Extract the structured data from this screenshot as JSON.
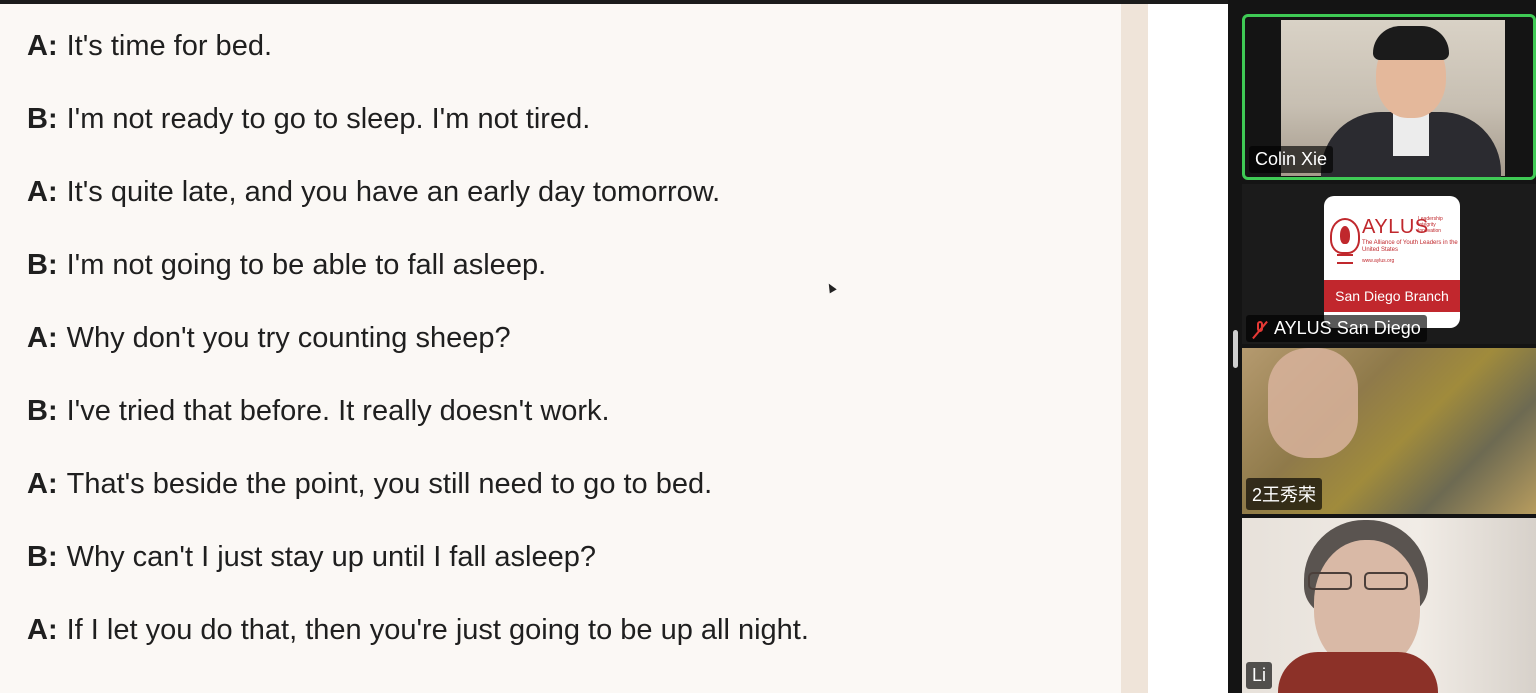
{
  "document": {
    "lines": [
      {
        "speaker": "A:",
        "text": "It's time for bed."
      },
      {
        "speaker": "B:",
        "text": "I'm not ready to go to sleep. I'm not tired."
      },
      {
        "speaker": "A:",
        "text": "It's quite late, and you have an early day tomorrow."
      },
      {
        "speaker": "B:",
        "text": "I'm not going to be able to fall asleep."
      },
      {
        "speaker": "A:",
        "text": "Why don't you try counting sheep?"
      },
      {
        "speaker": "B:",
        "text": "I've tried that before. It really doesn't work."
      },
      {
        "speaker": "A:",
        "text": "That's beside the point, you still need to go to bed."
      },
      {
        "speaker": "B:",
        "text": "Why can't I just stay up until I fall asleep?"
      },
      {
        "speaker": "A:",
        "text": "If I let you do that, then you're just going to be up all night."
      }
    ]
  },
  "participants": [
    {
      "name": "Colin Xie",
      "active_speaker": true
    },
    {
      "name": "AYLUS San Diego",
      "muted": true,
      "logo": {
        "brand": "AYLUS",
        "motto": "Leadership Integrity Innovation",
        "full_name": "The Alliance of Youth Leaders in the United States",
        "site": "www.aylus.org",
        "branch": "San Diego Branch"
      }
    },
    {
      "name": "2王秀荣"
    },
    {
      "name": "Li"
    }
  ],
  "colors": {
    "active_border": "#3fca55",
    "brand_red": "#c1272d",
    "doc_background": "#fbf8f5"
  }
}
